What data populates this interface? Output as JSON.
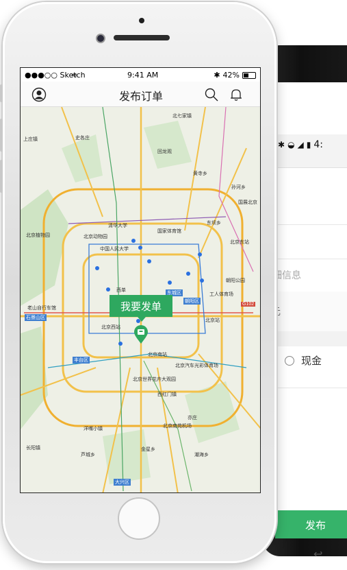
{
  "iphone": {
    "status": {
      "carrier": "●●●○○ Sketch",
      "wifi": "wifi-icon",
      "time": "9:41 AM",
      "bluetooth": "✱",
      "battery": "42%"
    },
    "nav": {
      "title": "发布订单",
      "left_icon": "user-avatar-icon",
      "right_icons": [
        "search-icon",
        "bell-icon"
      ]
    },
    "map": {
      "callout": "我要发单",
      "labels": [
        "北七家镇",
        "上庄镇",
        "史各庄",
        "回龙观",
        "黄寺乡",
        "孙河乡",
        "国展北京",
        "东坝乡",
        "清华大学",
        "国家体育馆",
        "北京植物园",
        "北京动物园",
        "中国人民大学",
        "北京东站",
        "朝阳公园",
        "工人体育场",
        "北京站",
        "老山自行车馆",
        "西单",
        "东城区",
        "朝阳区",
        "北京西站",
        "石景山区",
        "丰台区",
        "北京南站",
        "北京汽车光彩体育场",
        "北京世界花卉大观园",
        "西红门镇",
        "亦庄",
        "北京南苑机场",
        "洋嘴小镇",
        "长阳镇",
        "芦城乡",
        "金星乡",
        "潮海乡",
        "大兴区"
      ],
      "badges": [
        "G102",
        "G6",
        "G3",
        "东城区",
        "朝阳区"
      ],
      "fab_icon": "chevron-right-icon",
      "locate_icon": "locate-icon"
    }
  },
  "android": {
    "status_icons": [
      "bluetooth-icon",
      "wifi-icon",
      "signal-icon",
      "battery-icon"
    ],
    "status_time": "4:",
    "detail_placeholder": "详细信息",
    "unit_partial": "元",
    "payment_option": "现金",
    "publish_button": "发布",
    "back_icon": "back-icon"
  }
}
